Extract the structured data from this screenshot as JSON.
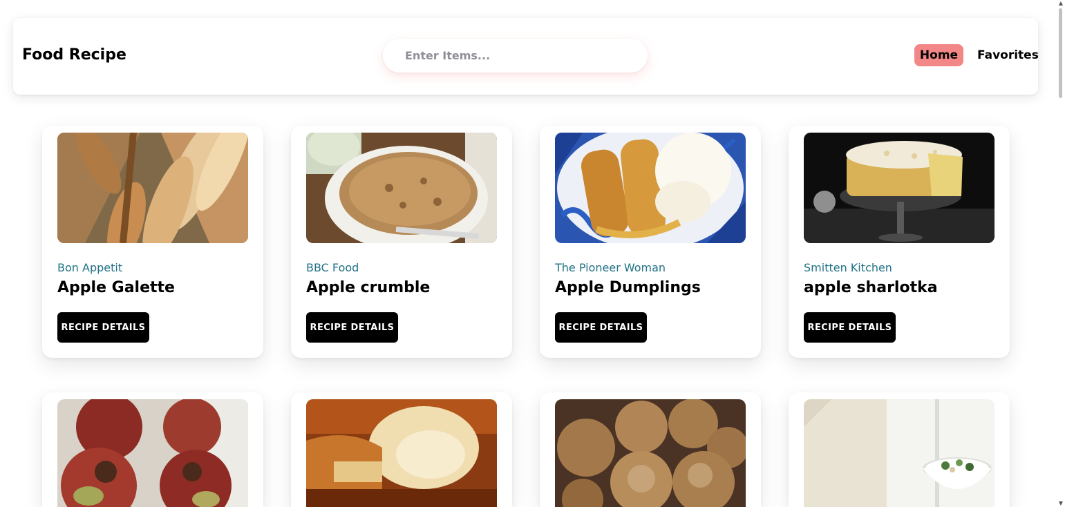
{
  "app": {
    "brand": "Food Recipe"
  },
  "search": {
    "placeholder": "Enter Items..."
  },
  "nav": {
    "home": "Home",
    "favorites": "Favorites",
    "active_color": "#f38686"
  },
  "cards": [
    {
      "source": "Bon Appetit",
      "title": "Apple Galette",
      "button": "RECIPE DETAILS"
    },
    {
      "source": "BBC Food",
      "title": "Apple crumble",
      "button": "RECIPE DETAILS"
    },
    {
      "source": "The Pioneer Woman",
      "title": "Apple Dumplings",
      "button": "RECIPE DETAILS"
    },
    {
      "source": "Smitten Kitchen",
      "title": "apple sharlotka",
      "button": "RECIPE DETAILS"
    }
  ],
  "colors": {
    "source_text": "#227287",
    "button_bg": "#000000"
  }
}
